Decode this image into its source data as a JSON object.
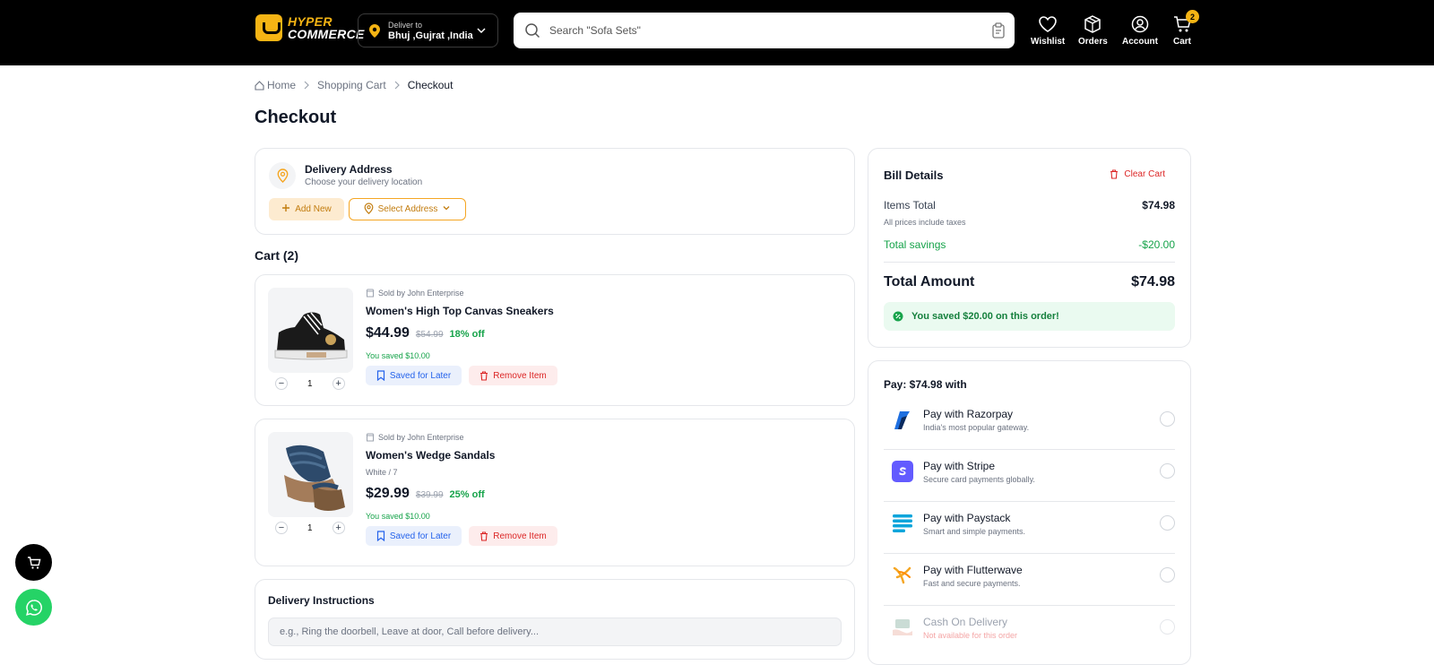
{
  "header": {
    "logo_line1": "HYPER",
    "logo_line2": "COMMERCE",
    "deliver_label": "Deliver to",
    "deliver_location": "Bhuj ,Gujrat ,India",
    "search_placeholder": "Search \"Sofa Sets\"",
    "nav": {
      "wishlist": "Wishlist",
      "orders": "Orders",
      "account": "Account",
      "cart": "Cart",
      "cart_count": "2"
    }
  },
  "breadcrumb": [
    "Home",
    "Shopping Cart",
    "Checkout"
  ],
  "page_title": "Checkout",
  "address": {
    "title": "Delivery Address",
    "subtitle": "Choose your delivery location",
    "add_new": "Add New",
    "select": "Select Address"
  },
  "cart": {
    "heading": "Cart (2)",
    "items": [
      {
        "seller": "Sold by John Enterprise",
        "name": "Women's High Top Canvas Sneakers",
        "price": "$44.99",
        "mrp": "$54.99",
        "off": "18% off",
        "saved": "You saved $10.00",
        "qty": "1",
        "save_later": "Saved for Later",
        "remove": "Remove Item"
      },
      {
        "seller": "Sold by John Enterprise",
        "name": "Women's Wedge Sandals",
        "variant": "White / 7",
        "price": "$29.99",
        "mrp": "$39.99",
        "off": "25% off",
        "saved": "You saved $10.00",
        "qty": "1",
        "save_later": "Saved for Later",
        "remove": "Remove Item"
      }
    ]
  },
  "instructions": {
    "title": "Delivery Instructions",
    "placeholder": "e.g., Ring the doorbell, Leave at door, Call before delivery..."
  },
  "bill": {
    "title": "Bill Details",
    "clear_cart": "Clear Cart",
    "items_total_label": "Items Total",
    "items_total": "$74.98",
    "tax_note": "All prices include taxes",
    "savings_label": "Total savings",
    "savings": "-$20.00",
    "total_label": "Total Amount",
    "total": "$74.98",
    "banner": "You saved $20.00 on this order!"
  },
  "payment": {
    "title": "Pay: $74.98 with",
    "options": [
      {
        "name": "Pay with Razorpay",
        "desc": "India's most popular gateway.",
        "icon": "razorpay-icon"
      },
      {
        "name": "Pay with Stripe",
        "desc": "Secure card payments globally.",
        "icon": "stripe-icon"
      },
      {
        "name": "Pay with Paystack",
        "desc": "Smart and simple payments.",
        "icon": "paystack-icon"
      },
      {
        "name": "Pay with Flutterwave",
        "desc": "Fast and secure payments.",
        "icon": "flutterwave-icon"
      },
      {
        "name": "Cash On Delivery",
        "desc": "Not available for this order",
        "icon": "cash-icon"
      }
    ]
  },
  "colors": {
    "accent": "#f5b414",
    "success": "#16a34a",
    "danger": "#dc2626",
    "link": "#2563eb"
  }
}
